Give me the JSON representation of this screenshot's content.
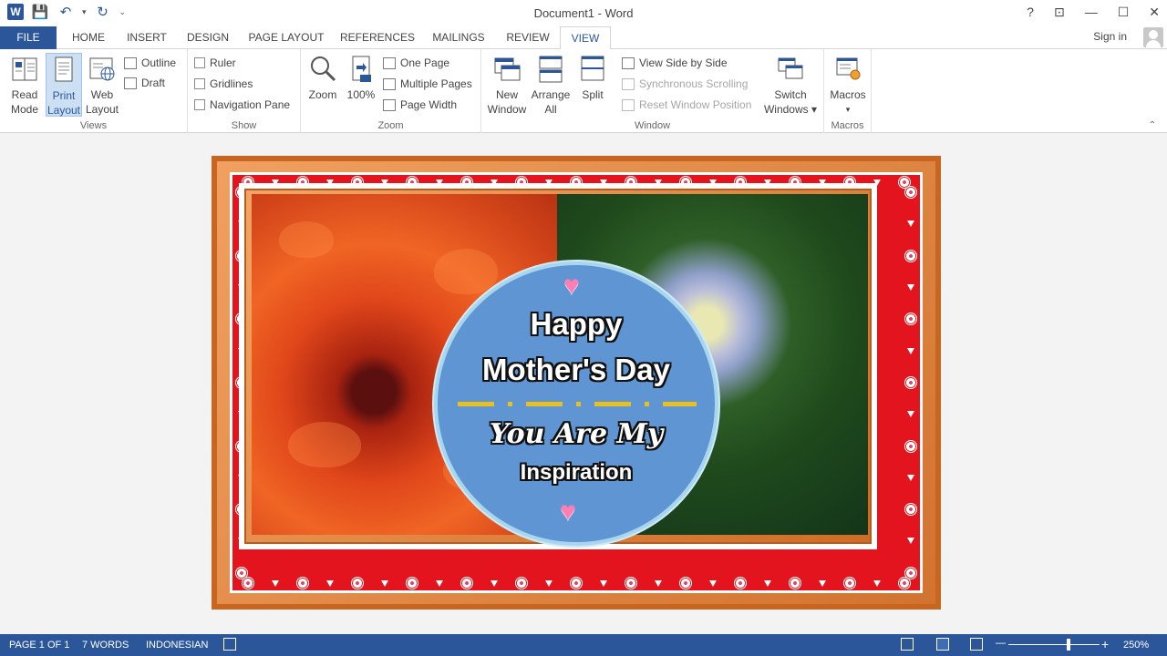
{
  "titlebar": {
    "title": "Document1 - Word",
    "app_icon": "W",
    "help": "?",
    "ribbon_display": "⊡",
    "minimize": "—",
    "maximize": "☐",
    "close": "✕"
  },
  "qat": {
    "save": "💾",
    "undo": "↶",
    "redo": "↻",
    "dropdown": "▾",
    "customize": "⌄"
  },
  "tabs": {
    "file": "FILE",
    "home": "HOME",
    "insert": "INSERT",
    "design": "DESIGN",
    "page_layout": "PAGE LAYOUT",
    "references": "REFERENCES",
    "mailings": "MAILINGS",
    "review": "REVIEW",
    "view": "VIEW"
  },
  "account": {
    "signin": "Sign in"
  },
  "ribbon": {
    "views": {
      "label": "Views",
      "read_mode": [
        "Read",
        "Mode"
      ],
      "print_layout": [
        "Print",
        "Layout"
      ],
      "web_layout": [
        "Web",
        "Layout"
      ],
      "outline": "Outline",
      "draft": "Draft"
    },
    "show": {
      "label": "Show",
      "ruler": "Ruler",
      "gridlines": "Gridlines",
      "nav_pane": "Navigation Pane"
    },
    "zoom": {
      "label": "Zoom",
      "zoom": "Zoom",
      "hundred": "100%",
      "one_page": "One Page",
      "multiple_pages": "Multiple Pages",
      "page_width": "Page Width"
    },
    "window": {
      "label": "Window",
      "new_window": [
        "New",
        "Window"
      ],
      "arrange_all": [
        "Arrange",
        "All"
      ],
      "split": "Split",
      "side_by_side": "View Side by Side",
      "sync_scroll": "Synchronous Scrolling",
      "reset_pos": "Reset Window Position",
      "switch_windows": [
        "Switch",
        "Windows ▾"
      ]
    },
    "macros": {
      "label": "Macros",
      "macros": "Macros",
      "arrow": "▾"
    }
  },
  "card": {
    "line1": "Happy",
    "line2": "Mother's Day",
    "line3": "You Are My",
    "line4": "Inspiration",
    "heart": "♥"
  },
  "status": {
    "page": "PAGE 1 OF 1",
    "words": "7 WORDS",
    "language": "INDONESIAN",
    "zoom": "250%",
    "minus": "—",
    "plus": "+"
  }
}
